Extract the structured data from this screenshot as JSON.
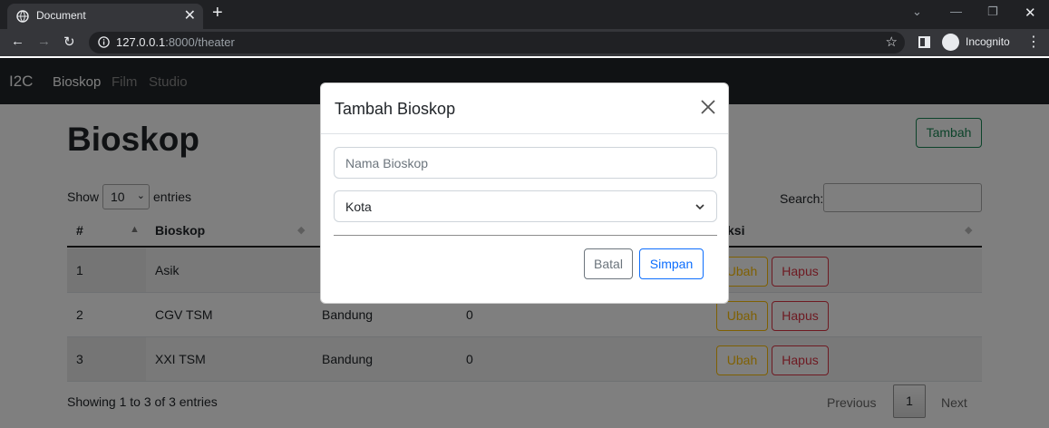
{
  "browser": {
    "tab_title": "Document",
    "url_host": "127.0.0.1",
    "url_rest": ":8000/theater",
    "profile_label": "Incognito"
  },
  "navbar": {
    "brand": "I2C",
    "links": [
      "Bioskop",
      "Film",
      "Studio"
    ]
  },
  "page": {
    "title": "Bioskop",
    "add_button": "Tambah",
    "length_prefix": "Show",
    "length_value": "10",
    "length_suffix": "entries",
    "search_label": "Search:"
  },
  "table": {
    "headers": [
      "#",
      "Bioskop",
      "ksi"
    ],
    "rows": [
      {
        "no": "1",
        "name": "Asik",
        "city": "",
        "count": ""
      },
      {
        "no": "2",
        "name": "CGV TSM",
        "city": "Bandung",
        "count": "0"
      },
      {
        "no": "3",
        "name": "XXI TSM",
        "city": "Bandung",
        "count": "0"
      }
    ],
    "edit_label": "Ubah",
    "delete_label": "Hapus"
  },
  "footer": {
    "info": "Showing 1 to 3 of 3 entries",
    "previous": "Previous",
    "current_page": "1",
    "next": "Next"
  },
  "modal": {
    "title": "Tambah Bioskop",
    "name_placeholder": "Nama Bioskop",
    "city_select": "Kota",
    "cancel_label": "Batal",
    "save_label": "Simpan"
  },
  "colors": {
    "success": "#198754",
    "warning": "#ffc107",
    "danger": "#dc3545",
    "primary": "#0d6efd",
    "navbar": "#212529"
  }
}
